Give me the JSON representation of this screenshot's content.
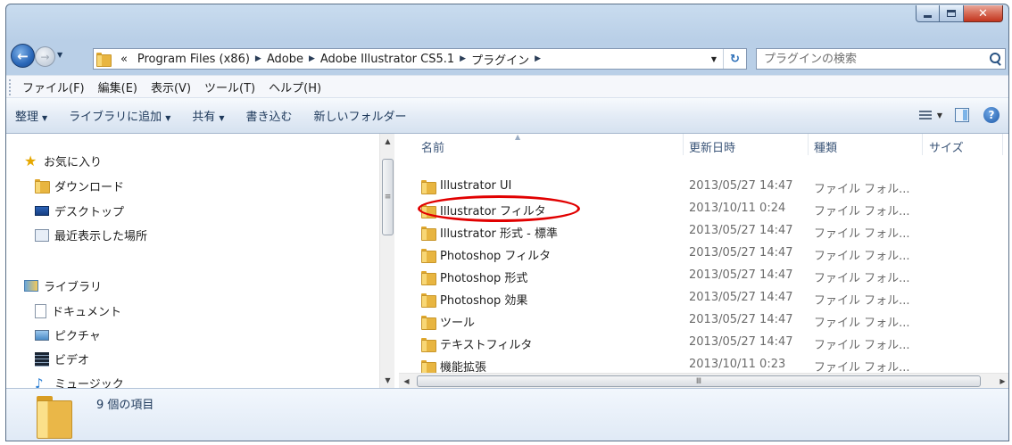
{
  "window": {
    "caption_buttons": {
      "minimize": "minimize",
      "maximize": "maximize",
      "close": "close"
    }
  },
  "nav": {
    "back_glyph": "←",
    "forward_glyph": "→",
    "history_glyph": "▼"
  },
  "address": {
    "overflow": "«",
    "crumbs": [
      "Program Files (x86)",
      "Adobe",
      "Adobe Illustrator CS5.1",
      "プラグイン"
    ],
    "separator": "▶",
    "dropdown_glyph": "▼",
    "refresh_glyph": "↻"
  },
  "search": {
    "placeholder": "プラグインの検索"
  },
  "menubar": {
    "items": [
      "ファイル(F)",
      "編集(E)",
      "表示(V)",
      "ツール(T)",
      "ヘルプ(H)"
    ]
  },
  "commandbar": {
    "organize": "整理",
    "add_to_library": "ライブラリに追加",
    "share": "共有",
    "burn": "書き込む",
    "new_folder": "新しいフォルダー",
    "dd_glyph": "▼",
    "help_glyph": "?"
  },
  "navpane": {
    "items": [
      {
        "label": "お気に入り",
        "icon": "star-icon"
      },
      {
        "label": "ダウンロード",
        "icon": "downloads-icon"
      },
      {
        "label": "デスクトップ",
        "icon": "desktop-icon"
      },
      {
        "label": "最近表示した場所",
        "icon": "recent-places-icon"
      },
      {
        "label": "ライブラリ",
        "icon": "library-icon"
      },
      {
        "label": "ドキュメント",
        "icon": "documents-icon"
      },
      {
        "label": "ピクチャ",
        "icon": "pictures-icon"
      },
      {
        "label": "ビデオ",
        "icon": "videos-icon"
      },
      {
        "label": "ミュージック",
        "icon": "music-icon"
      }
    ]
  },
  "columns": {
    "name": "名前",
    "date": "更新日時",
    "type": "種類",
    "size": "サイズ"
  },
  "files": [
    {
      "name": "Illustrator UI",
      "date": "2013/05/27 14:47",
      "type": "ファイル フォル..."
    },
    {
      "name": "Illustrator フィルタ",
      "date": "2013/10/11 0:24",
      "type": "ファイル フォル..."
    },
    {
      "name": "Illustrator 形式 - 標準",
      "date": "2013/05/27 14:47",
      "type": "ファイル フォル..."
    },
    {
      "name": "Photoshop フィルタ",
      "date": "2013/05/27 14:47",
      "type": "ファイル フォル..."
    },
    {
      "name": "Photoshop 形式",
      "date": "2013/05/27 14:47",
      "type": "ファイル フォル..."
    },
    {
      "name": "Photoshop 効果",
      "date": "2013/05/27 14:47",
      "type": "ファイル フォル..."
    },
    {
      "name": "ツール",
      "date": "2013/05/27 14:47",
      "type": "ファイル フォル..."
    },
    {
      "name": "テキストフィルタ",
      "date": "2013/05/27 14:47",
      "type": "ファイル フォル..."
    },
    {
      "name": "機能拡張",
      "date": "2013/10/11 0:23",
      "type": "ファイル フォル..."
    }
  ],
  "scroll": {
    "up": "▲",
    "down": "▼",
    "left": "◀",
    "right": "▶",
    "grip_v": "≡",
    "grip_h": "Ⅲ"
  },
  "details": {
    "item_count": "9 個の項目"
  },
  "colors": {
    "highlight": "#e10000",
    "folder": "#e8b540",
    "accent": "#1e395b"
  }
}
